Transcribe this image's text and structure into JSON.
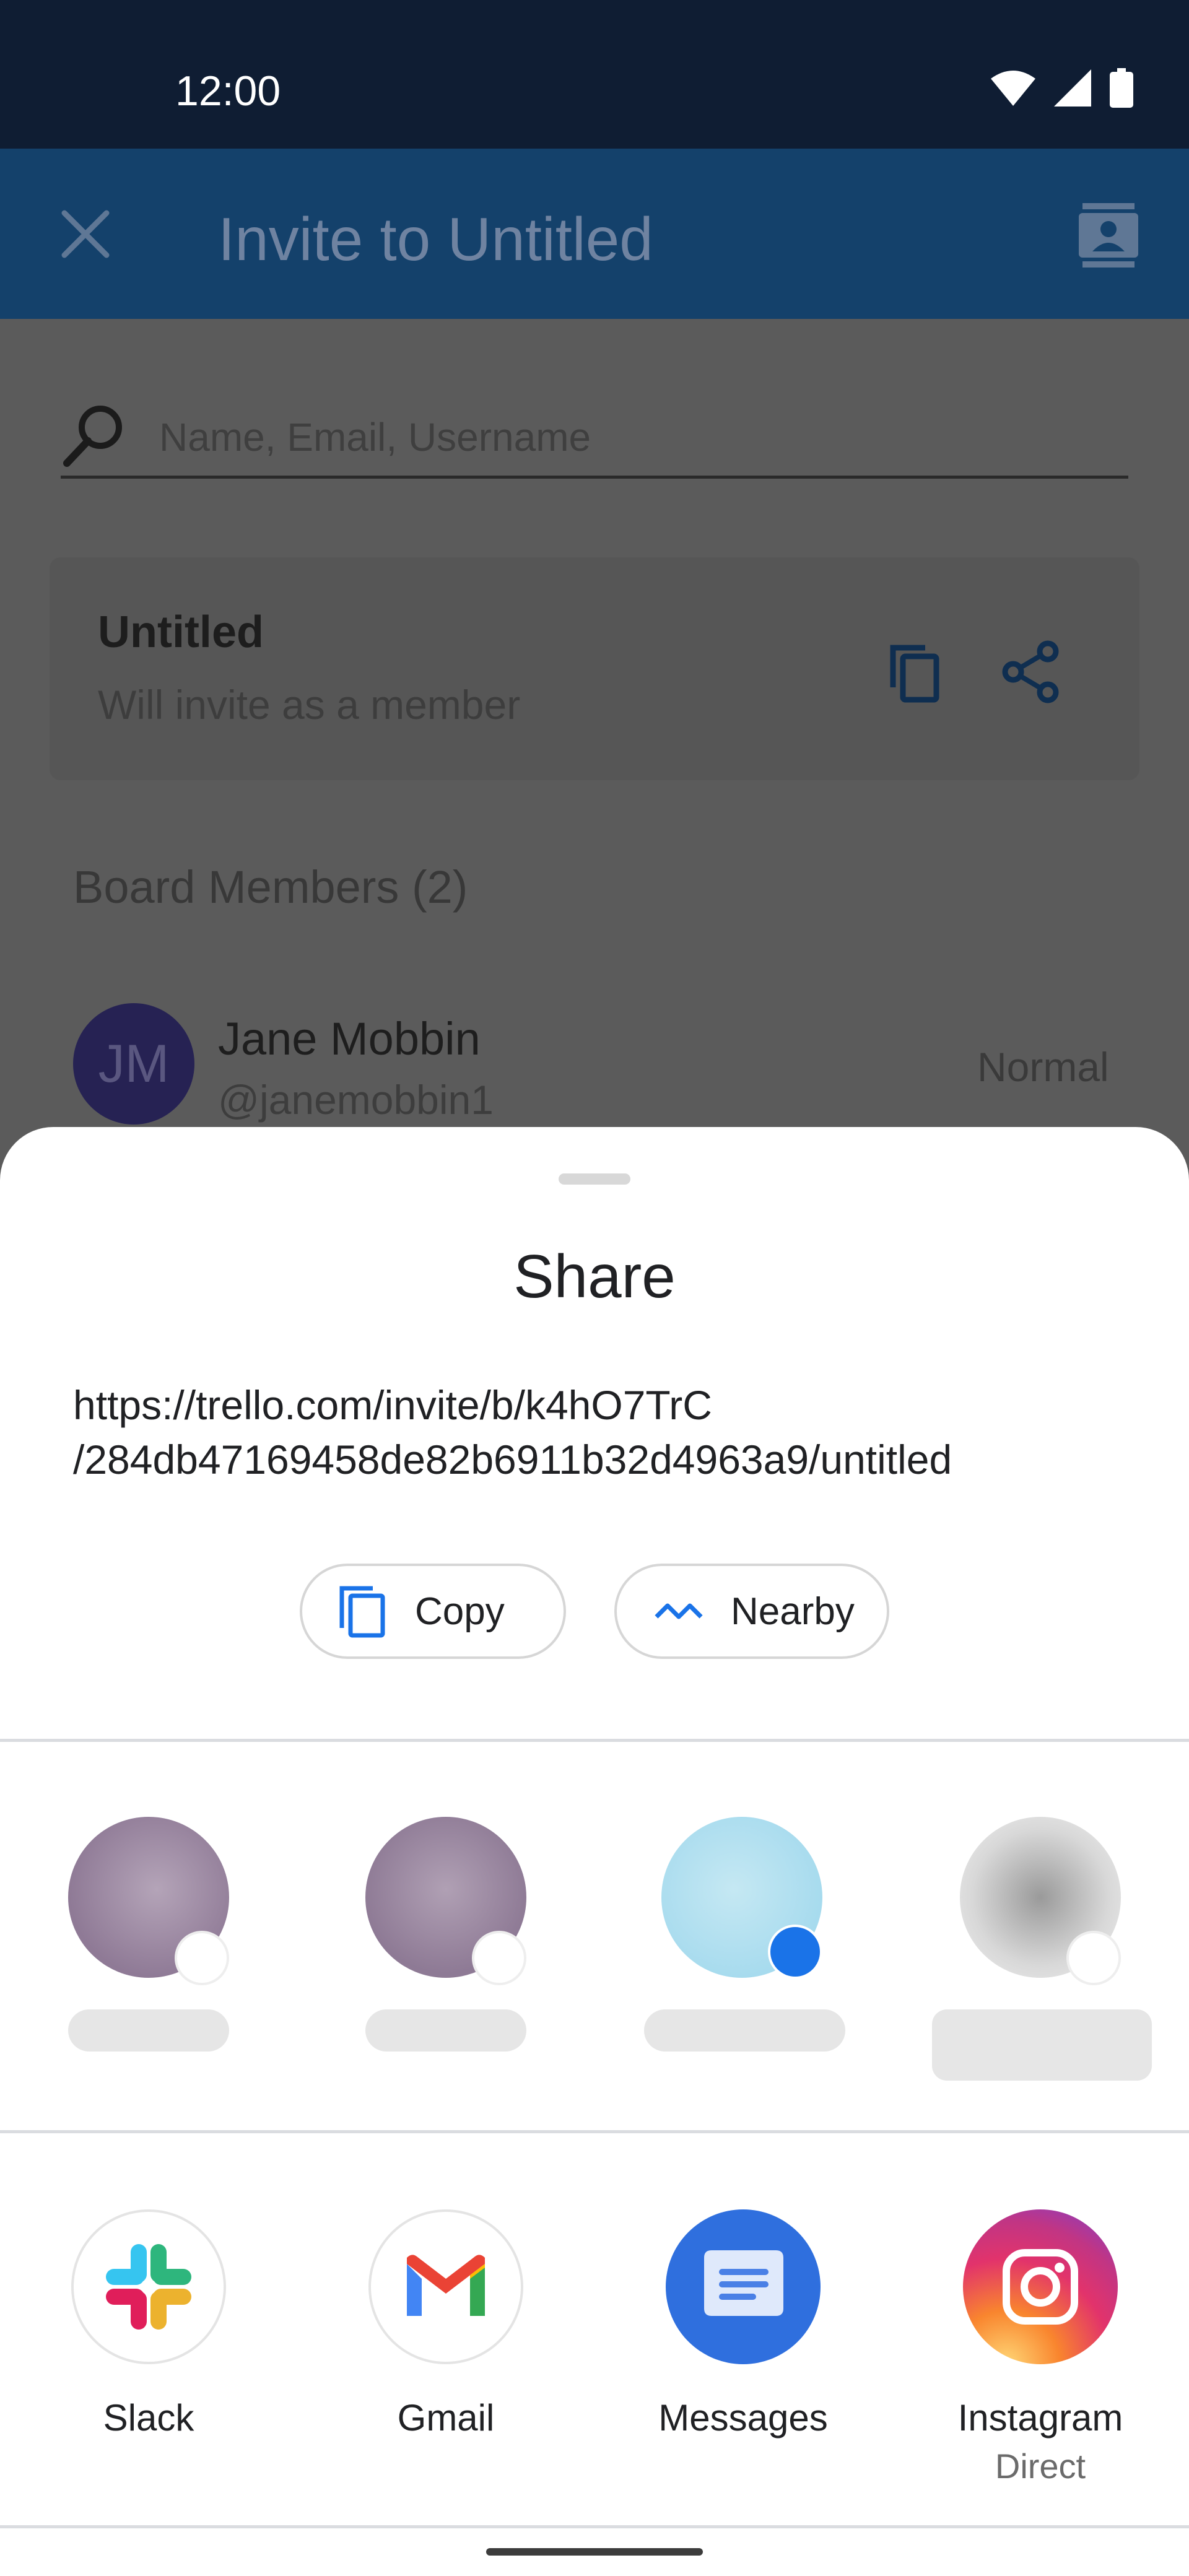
{
  "status_bar": {
    "time": "12:00",
    "icons": [
      "wifi-icon",
      "signal-icon",
      "battery-icon"
    ]
  },
  "app_bar": {
    "title": "Invite to Untitled",
    "close_icon": "close-icon",
    "contacts_icon": "contacts-icon"
  },
  "search": {
    "placeholder": "Name, Email, Username"
  },
  "invite_link_card": {
    "title": "Untitled",
    "subtitle": "Will invite as a member"
  },
  "members": {
    "header": "Board Members (2)",
    "items": [
      {
        "initials": "JM",
        "name": "Jane Mobbin",
        "username": "@janemobbin1",
        "role": "Normal"
      }
    ]
  },
  "share_sheet": {
    "title": "Share",
    "url": "https://trello.com/invite/b/k4hO7TrC\n/284db47169458de82b6911b32d4963a9/untitled",
    "actions": {
      "copy": "Copy",
      "nearby": "Nearby"
    },
    "apps": [
      {
        "label": "Slack",
        "sublabel": ""
      },
      {
        "label": "Gmail",
        "sublabel": ""
      },
      {
        "label": "Messages",
        "sublabel": ""
      },
      {
        "label": "Instagram",
        "sublabel": "Direct"
      }
    ]
  },
  "colors": {
    "accent_blue": "#1a73e8",
    "sheet_bg": "#ffffff",
    "scrim": "#5b5b5b",
    "app_bar_dim": "#14416b"
  }
}
